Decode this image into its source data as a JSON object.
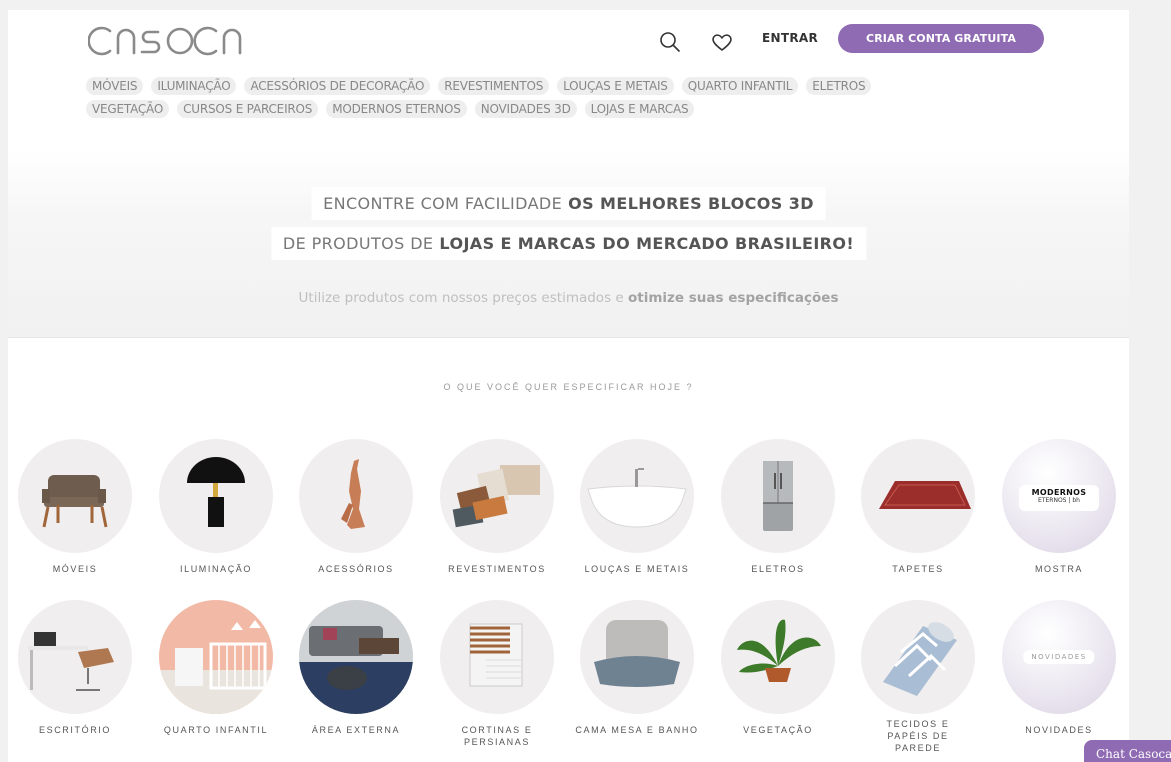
{
  "header": {
    "logo_text": "CASOCA",
    "login_label": "ENTRAR",
    "signup_label": "CRIAR CONTA GRATUITA"
  },
  "menu": {
    "row1": [
      "MÓVEIS",
      "ILUMINAÇÃO",
      "ACESSÓRIOS DE DECORAÇÃO",
      "REVESTIMENTOS",
      "LOUÇAS E METAIS",
      "QUARTO INFANTIL",
      "ELETROS"
    ],
    "row2": [
      "VEGETAÇÃO",
      "CURSOS E PARCEIROS",
      "MODERNOS ETERNOS",
      "NOVIDADES 3D",
      "LOJAS E MARCAS"
    ]
  },
  "hero": {
    "line1_light": "ENCONTRE COM FACILIDADE",
    "line1_bold": "OS MELHORES BLOCOS 3D",
    "line2_light": "DE PRODUTOS DE",
    "line2_bold": "LOJAS E MARCAS DO MERCADO BRASILEIRO!",
    "sub_light": "Utilize produtos com nossos preços estimados e",
    "sub_bold": "otimize suas especificações"
  },
  "section_title": "O QUE VOCÊ QUER ESPECIFICAR HOJE ?",
  "categories": [
    {
      "label": "MÓVEIS",
      "icon": "armchair-icon"
    },
    {
      "label": "ILUMINAÇÃO",
      "icon": "table-lamp-icon"
    },
    {
      "label": "ACESSÓRIOS",
      "icon": "sculpture-icon"
    },
    {
      "label": "REVESTIMENTOS",
      "icon": "tile-samples-icon"
    },
    {
      "label": "LOUÇAS E METAIS",
      "icon": "bathtub-icon"
    },
    {
      "label": "ELETROS",
      "icon": "refrigerator-icon"
    },
    {
      "label": "TAPETES",
      "icon": "rug-icon"
    },
    {
      "label": "MOSTRA",
      "icon": "modernos-eternos-logo",
      "tag_line1": "MODERNOS",
      "tag_line2": "ETERNOS | bh"
    },
    {
      "label": "ESCRITÓRIO",
      "icon": "office-icon"
    },
    {
      "label": "QUARTO INFANTIL",
      "icon": "crib-icon"
    },
    {
      "label": "ÁREA EXTERNA",
      "icon": "outdoor-furniture-icon"
    },
    {
      "label": "CORTINAS E PERSIANAS",
      "icon": "blinds-icon"
    },
    {
      "label": "CAMA MESA E BANHO",
      "icon": "bedding-icon"
    },
    {
      "label": "VEGETAÇÃO",
      "icon": "plant-icon"
    },
    {
      "label": "TECIDOS E PAPÉIS DE PAREDE",
      "icon": "wallpaper-roll-icon"
    },
    {
      "label": "NOVIDADES",
      "icon": "novidades-badge",
      "tag": "NOVIDADES"
    }
  ],
  "chat_label": "Chat Casoca",
  "colors": {
    "brand_purple": "#8f6bb3",
    "pill_bg": "#eeeeef",
    "pill_text": "#888888",
    "circle_bg": "#f0eeee"
  }
}
